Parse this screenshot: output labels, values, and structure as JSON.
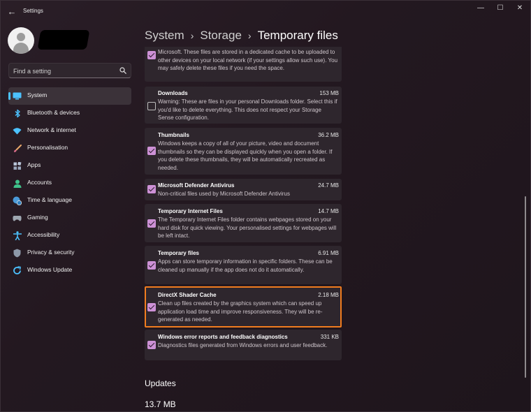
{
  "window": {
    "title": "Settings"
  },
  "window_controls": {
    "minimize": "—",
    "maximize": "☐",
    "close": "✕"
  },
  "search": {
    "placeholder": "Find a setting"
  },
  "sidebar": {
    "items": [
      {
        "label": "System",
        "icon": "monitor-icon",
        "active": true
      },
      {
        "label": "Bluetooth & devices",
        "icon": "bluetooth-icon"
      },
      {
        "label": "Network & internet",
        "icon": "wifi-icon"
      },
      {
        "label": "Personalisation",
        "icon": "brush-icon"
      },
      {
        "label": "Apps",
        "icon": "apps-icon"
      },
      {
        "label": "Accounts",
        "icon": "person-icon"
      },
      {
        "label": "Time & language",
        "icon": "globe-clock-icon"
      },
      {
        "label": "Gaming",
        "icon": "gamepad-icon"
      },
      {
        "label": "Accessibility",
        "icon": "accessibility-icon"
      },
      {
        "label": "Privacy & security",
        "icon": "shield-icon"
      },
      {
        "label": "Windows Update",
        "icon": "update-icon"
      }
    ]
  },
  "breadcrumb": {
    "items": [
      "System",
      "Storage"
    ],
    "current": "Temporary files",
    "separator": "›"
  },
  "files": [
    {
      "title": "",
      "size": "",
      "checked": true,
      "description": "Microsoft. These files are stored in a dedicated cache to be uploaded to other devices on your local network (if your settings allow such use). You may safely delete these files if you need the space."
    },
    {
      "title": "Downloads",
      "size": "153 MB",
      "checked": false,
      "description": "Warning: These are files in your personal Downloads folder. Select this if you'd like to delete everything. This does not respect your Storage Sense configuration."
    },
    {
      "title": "Thumbnails",
      "size": "36.2 MB",
      "checked": true,
      "description": "Windows keeps a copy of all of your picture, video and document thumbnails so they can be displayed quickly when you open a folder. If you delete these thumbnails, they will be automatically recreated as needed."
    },
    {
      "title": "Microsoft Defender Antivirus",
      "size": "24.7 MB",
      "checked": true,
      "description": "Non-critical files used by Microsoft Defender Antivirus"
    },
    {
      "title": "Temporary Internet Files",
      "size": "14.7 MB",
      "checked": true,
      "description": "The Temporary Internet Files folder contains webpages stored on your hard disk for quick viewing. Your personalised settings for webpages will be left intact."
    },
    {
      "title": "Temporary files",
      "size": "6.91 MB",
      "checked": true,
      "description": "Apps can store temporary information in specific folders. These can be cleaned up manually if the app does not do it automatically."
    },
    {
      "title": "DirectX Shader Cache",
      "size": "2.18 MB",
      "checked": true,
      "description": "Clean up files created by the graphics system which can speed up application load time and improve responsiveness. They will be re-generated as needed."
    },
    {
      "title": "Windows error reports and feedback diagnostics",
      "size": "331 KB",
      "checked": true,
      "description": "Diagnostics files generated from Windows errors and user feedback."
    }
  ],
  "updates": {
    "title": "Updates",
    "size": "13.7 MB"
  },
  "colors": {
    "accent": "#4cc2ff",
    "checkbox": "#cd91d6",
    "highlight": "#f07c1f"
  }
}
